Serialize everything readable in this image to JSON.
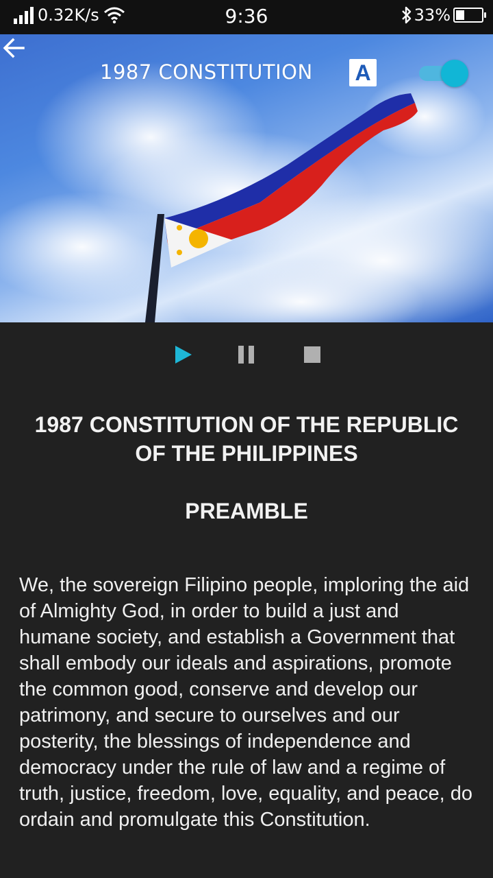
{
  "status_bar": {
    "net_speed": "0.32K/s",
    "time": "9:36",
    "battery_percent": "33%",
    "battery_level": 0.33,
    "icons": [
      "signal-icon",
      "wifi-icon",
      "bluetooth-icon",
      "battery-icon"
    ]
  },
  "toolbar": {
    "title": "1987 CONSTITUTION",
    "font_button_label": "A",
    "toggle_on": true,
    "accent_color": "#11b6d6"
  },
  "player": {
    "icons": [
      "play-icon",
      "pause-icon",
      "stop-icon"
    ],
    "play_color": "#1eb6d6",
    "inactive_color": "#b0b0b0"
  },
  "document": {
    "title": "1987 CONSTITUTION OF THE REPUBLIC OF THE PHILIPPINES",
    "section": "PREAMBLE",
    "body": "We, the sovereign Filipino people, imploring the aid of Almighty God, in order to build a just and humane society, and establish a Government that shall embody our ideals and aspirations, promote the common good, conserve and develop our patrimony, and secure to ourselves and our posterity, the blessings of independence and democracy under the rule of law and a regime of truth, justice, freedom, love, equality, and peace, do ordain and promulgate this Constitution."
  }
}
